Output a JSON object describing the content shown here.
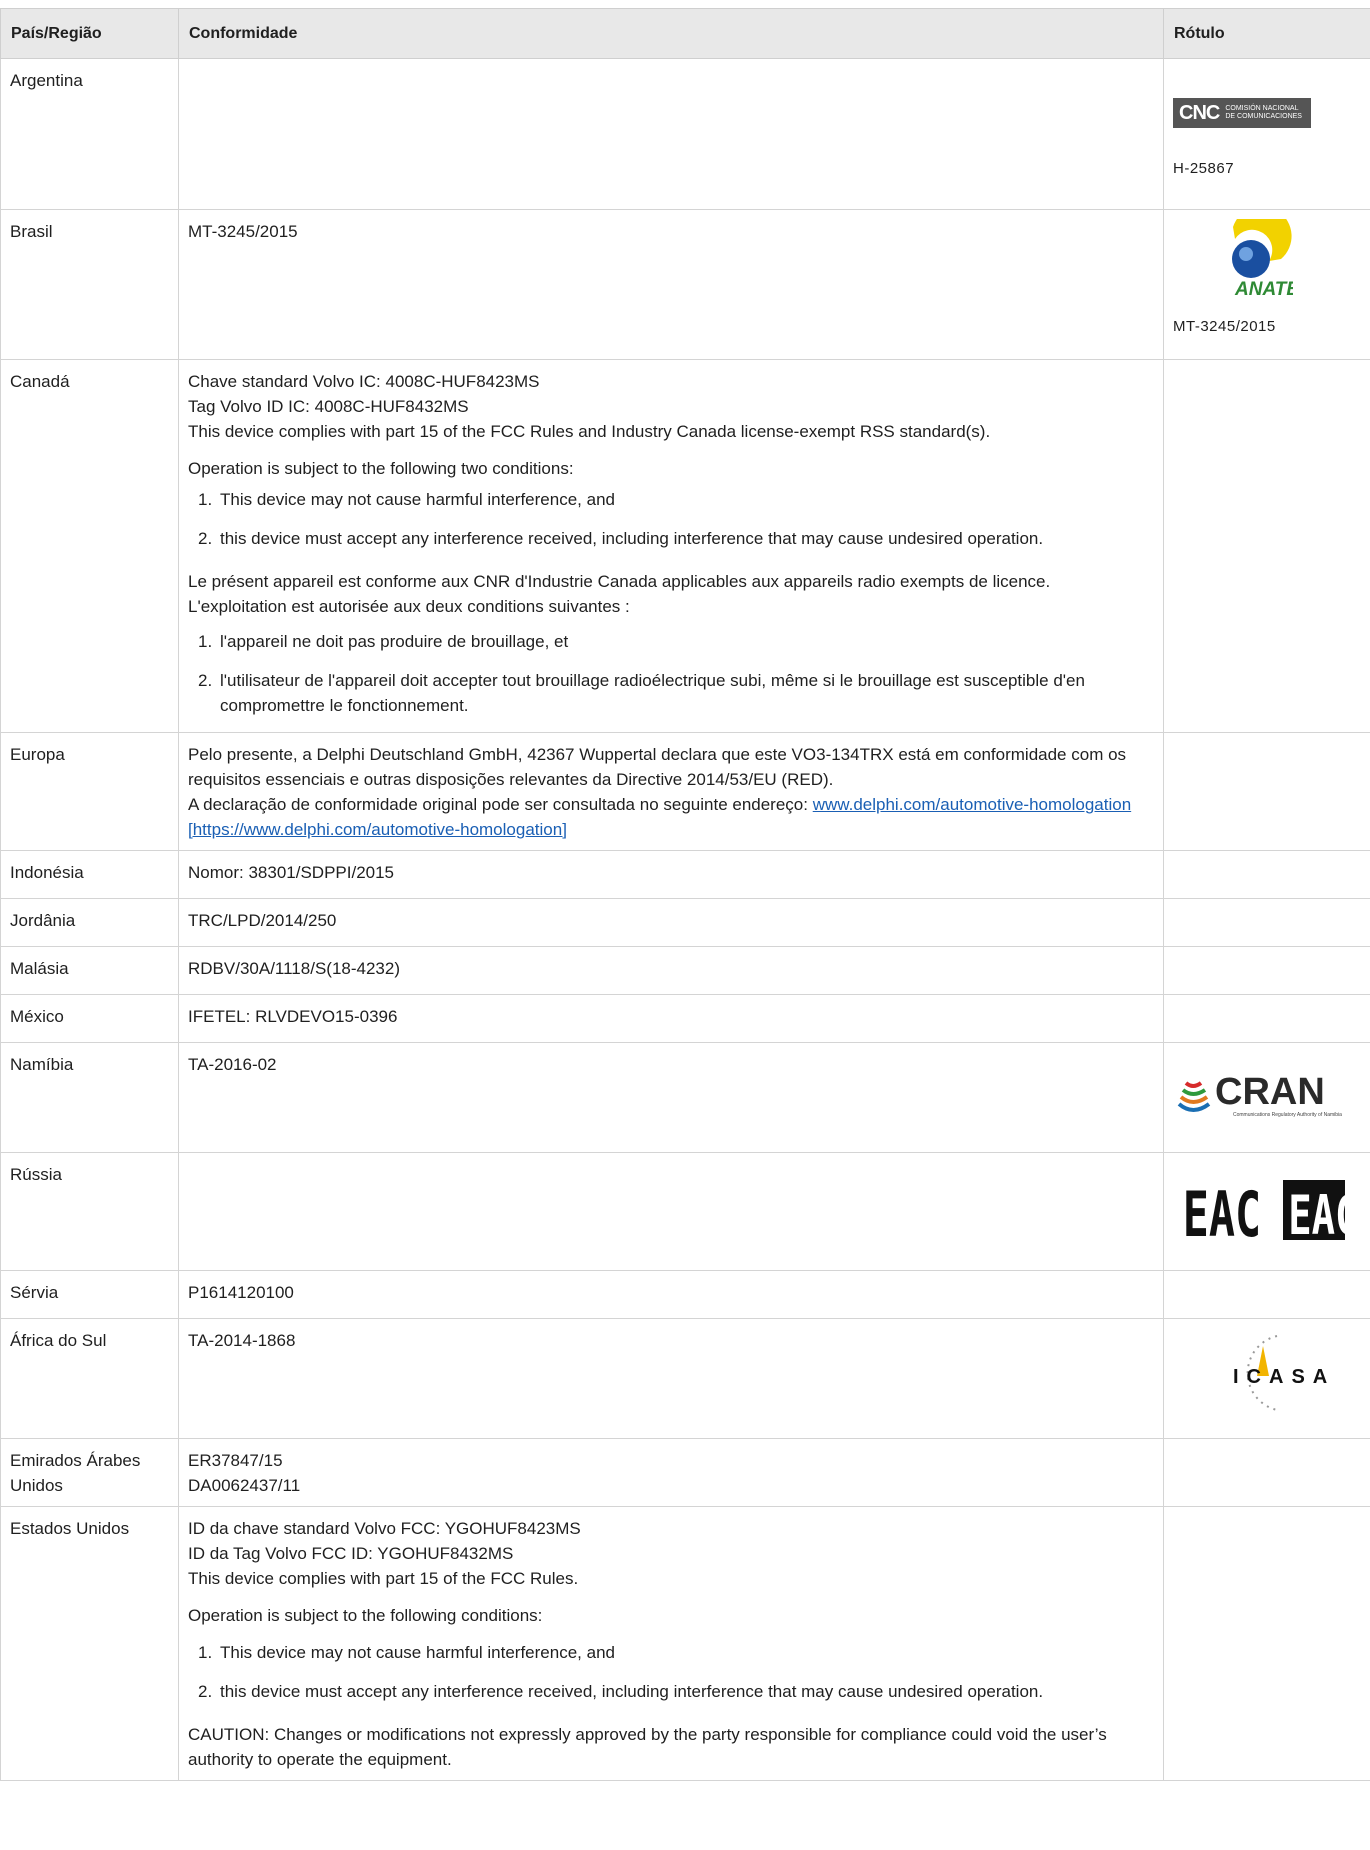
{
  "headers": {
    "country": "País/Região",
    "compliance": "Conformidade",
    "label": "Rótulo"
  },
  "rows": {
    "argentina": {
      "country": "Argentina",
      "label_text": "H-25867",
      "logo": {
        "brand": "CNC",
        "sub1": "COMISIÓN NACIONAL",
        "sub2": "DE COMUNICACIONES"
      }
    },
    "brasil": {
      "country": "Brasil",
      "text": "MT-3245/2015",
      "label_text": "MT-3245/2015",
      "logo": {
        "brand": "ANATEL",
        "colors": {
          "blue": "#1a4fa0",
          "yellow": "#f2d200",
          "green": "#2f8a35"
        }
      }
    },
    "canada": {
      "country": "Canadá",
      "l1": "Chave standard Volvo IC: 4008C-HUF8423MS",
      "l2": "Tag Volvo ID IC: 4008C-HUF8432MS",
      "l3": "This device complies with part 15 of the FCC Rules and Industry Canada license-exempt RSS standard(s).",
      "l4": "Operation is subject to the following two conditions:",
      "i1": "This device may not cause harmful interference, and",
      "i2": "this device must accept any interference received, including interference that may cause undesired operation.",
      "l5": "Le présent appareil est conforme aux CNR d'Industrie Canada applicables aux appareils radio exempts de licence.",
      "l6": "L'exploitation est autorisée aux deux conditions suivantes :",
      "i3": "l'appareil ne doit pas produire de brouillage, et",
      "i4": "l'utilisateur de l'appareil doit accepter tout brouillage radioélectrique subi, même si le brouillage est susceptible d'en compromettre le fonctionnement."
    },
    "europa": {
      "country": "Europa",
      "l1": "Pelo presente, a Delphi Deutschland GmbH, 42367 Wuppertal declara que este VO3-134TRX está em conformidade com os requisitos essenciais e outras disposições relevantes da Directive 2014/53/EU (RED).",
      "l2": "A declaração de conformidade original pode ser consultada no seguinte endereço:",
      "link": "www.delphi.com/automotive-homologation [https://www.delphi.com/automotive-homologation]"
    },
    "indonesia": {
      "country": "Indonésia",
      "text": "Nomor: 38301/SDPPI/2015"
    },
    "jordania": {
      "country": "Jordânia",
      "text": "TRC/LPD/2014/250"
    },
    "malasia": {
      "country": "Malásia",
      "text": "RDBV/30A/1118/S(18-4232)"
    },
    "mexico": {
      "country": "México",
      "text": "IFETEL: RLVDEVO15-0396"
    },
    "namibia": {
      "country": "Namíbia",
      "text": "TA-2016-02",
      "logo": {
        "brand": "CRAN",
        "sub": "Communications Regulatory Authority of Namibia"
      }
    },
    "russia": {
      "country": "Rússia",
      "logo": {
        "brand": "EAC"
      }
    },
    "servia": {
      "country": "Sérvia",
      "text": "P1614120100"
    },
    "africa": {
      "country": "África do Sul",
      "text": "TA-2014-1868",
      "logo": {
        "brand": "ICASA"
      }
    },
    "emirados": {
      "country": "Emirados Árabes Unidos",
      "l1": "ER37847/15",
      "l2": "DA0062437/11"
    },
    "eua": {
      "country": "Estados Unidos",
      "l1": "ID da chave standard Volvo FCC: YGOHUF8423MS",
      "l2": "ID da Tag Volvo FCC ID: YGOHUF8432MS",
      "l3": "This device complies with part 15 of the FCC Rules.",
      "l4": "Operation is subject to the following conditions:",
      "i1": "This device may not cause harmful interference, and",
      "i2": "this device must accept any interference received, including interference that may cause undesired operation.",
      "l5": "CAUTION: Changes or modifications not expressly approved by the party responsible for compliance could void the user’s authority to operate the equipment."
    }
  }
}
